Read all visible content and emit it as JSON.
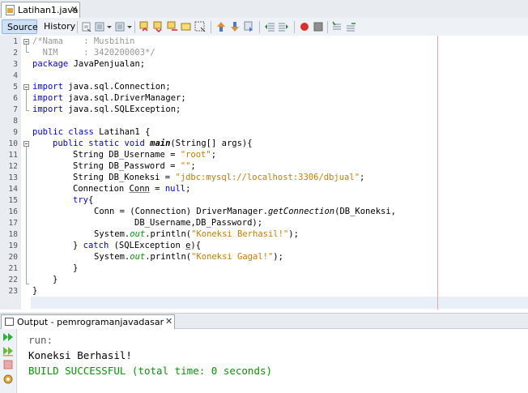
{
  "editor_tab": {
    "filename": "Latihan1.java",
    "close": "✕"
  },
  "view_tabs": {
    "source": "Source",
    "history": "History"
  },
  "toolbar": {
    "buttons": [
      "last-edit-icon",
      "back-icon",
      "forward-icon",
      "find-previous-icon",
      "find-next-icon",
      "find-selection-icon",
      "toggle-highlight-icon",
      "toggle-rect-select-icon",
      "previous-bookmark-icon",
      "next-bookmark-icon",
      "toggle-bookmark-icon",
      "shift-left-icon",
      "shift-right-icon",
      "start-macro-icon",
      "stop-macro-icon",
      "comment-icon",
      "uncomment-icon"
    ]
  },
  "line_numbers": [
    "1",
    "2",
    "3",
    "4",
    "5",
    "6",
    "7",
    "8",
    "9",
    "10",
    "11",
    "12",
    "13",
    "14",
    "15",
    "16",
    "17",
    "18",
    "19",
    "20",
    "21",
    "22",
    "23"
  ],
  "code": {
    "l1_a": "/*Nama    : Musbihin",
    "l2_a": "  NIM     : 3420200003*/",
    "l3_kw": "package",
    "l3_rest": " JavaPenjualan;",
    "l5_kw": "import",
    "l5_rest": " java.sql.Connection;",
    "l6_kw": "import",
    "l6_rest": " java.sql.DriverManager;",
    "l7_kw": "import",
    "l7_rest": " java.sql.SQLException;",
    "l9_kw": "public class",
    "l9_rest": " Latihan1 {",
    "l10_kw": "public static void",
    "l10_m": "main",
    "l10_rest": "(String[] args){",
    "l11_a": "String DB_Username = ",
    "l11_s": "\"root\"",
    "l11_e": ";",
    "l12_a": "String DB_Password = ",
    "l12_s": "\"\"",
    "l12_e": ";",
    "l13_a": "String DB_Koneksi = ",
    "l13_s": "\"jdbc:mysql://localhost:3306/dbjual\"",
    "l13_e": ";",
    "l14_a": "Connection ",
    "l14_u": "Conn",
    "l14_b": " = ",
    "l14_k": "null",
    "l14_e": ";",
    "l15_kw": "try",
    "l15_e": "{",
    "l16_a": "Conn = (Connection) DriverManager.",
    "l16_i": "getConnection",
    "l16_e": "(DB_Koneksi,",
    "l17_a": "DB_Username,DB_Password);",
    "l18_a": "System.",
    "l18_f": "out",
    "l18_b": ".println(",
    "l18_s": "\"Koneksi Berhasil!\"",
    "l18_e": ");",
    "l19_a": "} ",
    "l19_k": "catch",
    "l19_b": " (SQLException ",
    "l19_u": "e",
    "l19_e": "){",
    "l20_a": "System.",
    "l20_f": "out",
    "l20_b": ".println(",
    "l20_s": "\"Koneksi Gagal!\"",
    "l20_e": ");",
    "l21_a": "}",
    "l22_a": "}",
    "l23_a": "}"
  },
  "output": {
    "tab_label": "Output - pemrogramanjavadasar (run)",
    "close": "✕",
    "lines": [
      "run:",
      "Koneksi Berhasil!",
      "BUILD SUCCESSFUL (total time: 0 seconds)"
    ],
    "side_buttons": [
      "rerun-icon",
      "rerun-debug-icon",
      "stop-icon",
      "settings-icon"
    ]
  },
  "colors": {
    "keyword": "#0000e6",
    "string": "#ce7b00",
    "comment": "#969696",
    "field": "#009900",
    "build_success": "#009900",
    "output_info": "#5c5c5c"
  }
}
